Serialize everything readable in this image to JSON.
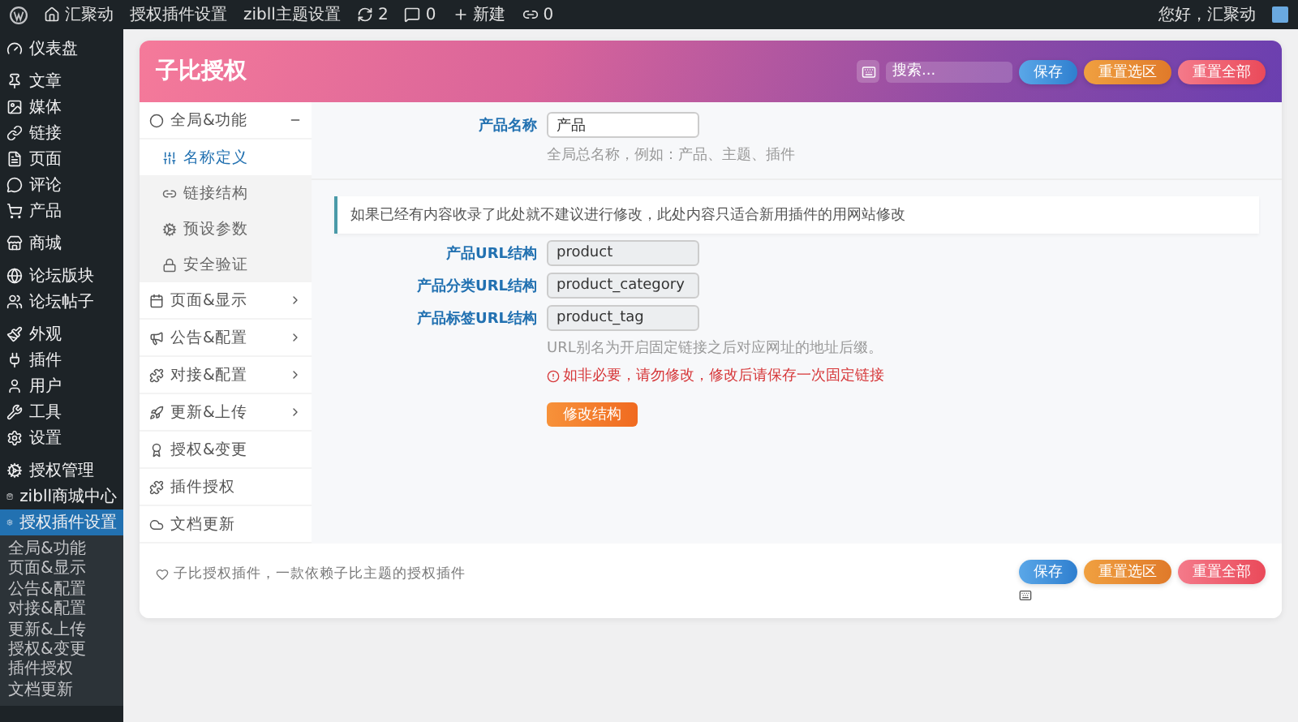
{
  "admin_bar": {
    "site": "汇聚动",
    "links": [
      "授权插件设置",
      "zibll主题设置"
    ],
    "updates": "2",
    "comments": "0",
    "new": "新建",
    "link_count": "0",
    "greeting": "您好，汇聚动"
  },
  "sidebar": {
    "groups": [
      [
        {
          "label": "仪表盘",
          "selected": false
        }
      ],
      [
        {
          "label": "文章",
          "selected": false
        },
        {
          "label": "媒体",
          "selected": false
        },
        {
          "label": "链接",
          "selected": false
        },
        {
          "label": "页面",
          "selected": false
        },
        {
          "label": "评论",
          "selected": false
        },
        {
          "label": "产品",
          "selected": false
        }
      ],
      [
        {
          "label": "商城",
          "selected": false
        }
      ],
      [
        {
          "label": "论坛版块",
          "selected": false
        },
        {
          "label": "论坛帖子",
          "selected": false
        }
      ],
      [
        {
          "label": "外观",
          "selected": false
        },
        {
          "label": "插件",
          "selected": false
        },
        {
          "label": "用户",
          "selected": false
        },
        {
          "label": "工具",
          "selected": false
        },
        {
          "label": "设置",
          "selected": false
        }
      ],
      [
        {
          "label": "授权管理",
          "selected": false
        },
        {
          "label": "zibll商城中心",
          "selected": false
        },
        {
          "label": "授权插件设置",
          "selected": true
        }
      ]
    ],
    "submenu": [
      "全局&功能",
      "页面&显示",
      "公告&配置",
      "对接&配置",
      "更新&上传",
      "授权&变更",
      "插件授权",
      "文档更新"
    ]
  },
  "header": {
    "title": "子比授权",
    "search": {
      "placeholder": "搜索..."
    },
    "buttons": [
      {
        "label": "保存",
        "kind": "save"
      },
      {
        "label": "重置选区",
        "kind": "reset-section"
      },
      {
        "label": "重置全部",
        "kind": "reset-all"
      }
    ]
  },
  "nav": [
    {
      "label": "全局&功能",
      "kind": "group",
      "expanded": true,
      "children": [
        {
          "label": "名称定义",
          "selected": true
        },
        {
          "label": "链接结构",
          "selected": false
        },
        {
          "label": "预设参数",
          "selected": false
        },
        {
          "label": "安全验证",
          "selected": false
        }
      ]
    },
    {
      "label": "页面&显示",
      "kind": "group",
      "expanded": false
    },
    {
      "label": "公告&配置",
      "kind": "group",
      "expanded": false
    },
    {
      "label": "对接&配置",
      "kind": "group",
      "expanded": false
    },
    {
      "label": "更新&上传",
      "kind": "group",
      "expanded": false
    },
    {
      "label": "授权&变更",
      "kind": "link"
    },
    {
      "label": "插件授权",
      "kind": "link"
    },
    {
      "label": "文档更新",
      "kind": "link"
    }
  ],
  "name_section": {
    "label": "产品名称",
    "value": "产品",
    "hint": "全局总名称，例如：产品、主题、插件"
  },
  "url_section": {
    "notice": "如果已经有内容收录了此处就不建议进行修改，此处内容只适合新用插件的用网站修改",
    "fields": [
      {
        "label": "产品URL结构",
        "value": "product"
      },
      {
        "label": "产品分类URL结构",
        "value": "product_category"
      },
      {
        "label": "产品标签URL结构",
        "value": "product_tag"
      }
    ],
    "hint": "URL别名为开启固定链接之后对应网址的地址后缀。",
    "warning": "如非必要，请勿修改，修改后请保存一次固定链接",
    "button": "修改结构"
  },
  "footer": {
    "text": "子比授权插件，一款依赖子比主题的授权插件",
    "buttons": [
      {
        "label": "保存",
        "kind": "save"
      },
      {
        "label": "重置选区",
        "kind": "reset-section"
      },
      {
        "label": "重置全部",
        "kind": "reset-all"
      }
    ]
  }
}
